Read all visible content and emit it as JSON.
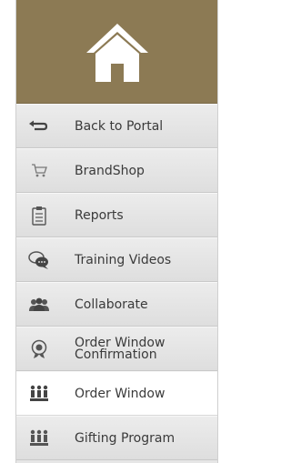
{
  "menu": {
    "items": [
      {
        "id": "back",
        "label": "Back to Portal",
        "icon": "back-arrow-icon"
      },
      {
        "id": "brandshop",
        "label": "BrandShop",
        "icon": "shopping-cart-icon"
      },
      {
        "id": "reports",
        "label": "Reports",
        "icon": "clipboard-icon"
      },
      {
        "id": "training",
        "label": "Training Videos",
        "icon": "chat-bubbles-icon"
      },
      {
        "id": "collaborate",
        "label": "Collaborate",
        "icon": "group-people-icon"
      },
      {
        "id": "orderconf",
        "label_line1": "Order Window",
        "label_line2": "Confirmation",
        "icon": "badge-icon"
      },
      {
        "id": "orderwindow",
        "label": "Order Window",
        "icon": "people-row-icon",
        "active": true
      },
      {
        "id": "gifting",
        "label": "Gifting Program",
        "icon": "people-row-icon"
      }
    ]
  },
  "colors": {
    "header_bg": "#8c7a54",
    "icon_dark": "#444444",
    "icon_light": "#7a7a7a"
  }
}
